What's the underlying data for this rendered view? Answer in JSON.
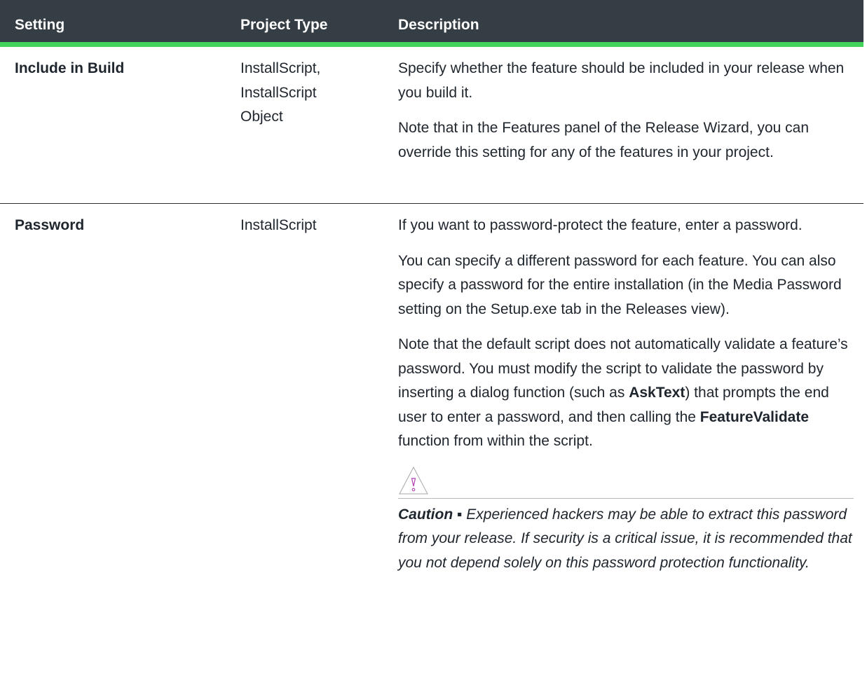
{
  "header": {
    "setting": "Setting",
    "project_type": "Project Type",
    "description": "Description"
  },
  "rows": [
    {
      "setting": "Include in Build",
      "project_type_lines": [
        "InstallScript,",
        "InstallScript",
        "Object"
      ],
      "description": [
        "Specify whether the feature should be included in your release when you build it.",
        "Note that in the Features panel of the Release Wizard, you can override this setting for any of the features in your project."
      ]
    },
    {
      "setting": "Password",
      "project_type_lines": [
        "InstallScript"
      ],
      "description": [
        "If you want to password-protect the feature, enter a password.",
        "You can specify a different password for each feature. You can also specify a password for the entire installation (in the Media Password setting on the Setup.exe tab in the Releases view)."
      ],
      "note": {
        "before_ask": "Note that the default script does not automatically validate a feature’s password. You must modify the script to validate the password by inserting a dialog function (such as ",
        "ask_text": "AskText",
        "middle": ") that prompts the end user to enter a password, and then calling the ",
        "feature_validate": "FeatureValidate",
        "after": " function from within the script."
      },
      "caution": {
        "icon": "caution-triangle-icon",
        "label": "Caution ▪",
        "text": "Experienced hackers may be able to extract this password from your release. If security is a critical issue, it is recommended that you not depend solely on this password protection functionality."
      }
    }
  ],
  "colors": {
    "header_bg": "#353d45",
    "header_accent": "#44d35a",
    "text": "#1e252d"
  }
}
